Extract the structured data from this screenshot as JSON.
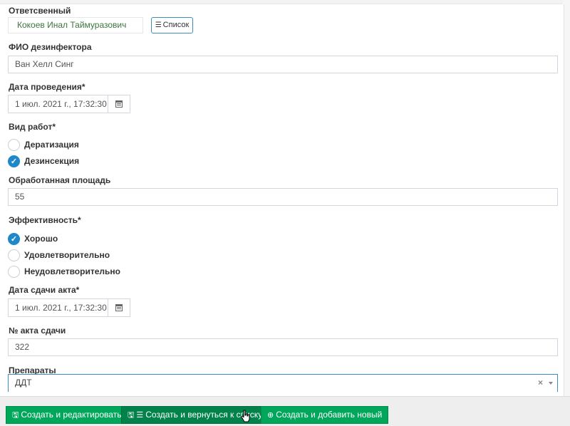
{
  "responsible": {
    "label": "Ответсвенный",
    "value": "Кокоев Инал Таймуразович",
    "list_button": "Список",
    "list_icon": "list-icon"
  },
  "disinfector": {
    "label": "ФИО дезинфектора",
    "value": "Ван Хелл Синг"
  },
  "date_held": {
    "label": "Дата проведения*",
    "value": "1 июл. 2021 г., 17:32:30",
    "icon": "calendar-icon"
  },
  "work_type": {
    "label": "Вид работ*",
    "options": [
      {
        "label": "Дератизация",
        "checked": false
      },
      {
        "label": "Дезинсекция",
        "checked": true
      }
    ]
  },
  "area": {
    "label": "Обработанная площадь",
    "value": "55"
  },
  "efficiency": {
    "label": "Эффективность*",
    "options": [
      {
        "label": "Хорошо",
        "checked": true
      },
      {
        "label": "Удовлетворительно",
        "checked": false
      },
      {
        "label": "Неудовлетворительно",
        "checked": false
      }
    ]
  },
  "act_date": {
    "label": "Дата сдачи акта*",
    "value": "1 июл. 2021 г., 17:32:30",
    "icon": "calendar-icon"
  },
  "act_number": {
    "label": "№ акта сдачи",
    "value": "322"
  },
  "preparations": {
    "label": "Препараты",
    "value": "ДДТ",
    "clear": "×"
  },
  "footer": {
    "create_edit": "Создать и редактировать",
    "create_return": "Создать и вернуться к списку",
    "create_new": "Создать и добавить новый"
  },
  "colors": {
    "primary": "#1f88c9",
    "success": "#00a65a",
    "responsible_text": "#3c763d"
  }
}
